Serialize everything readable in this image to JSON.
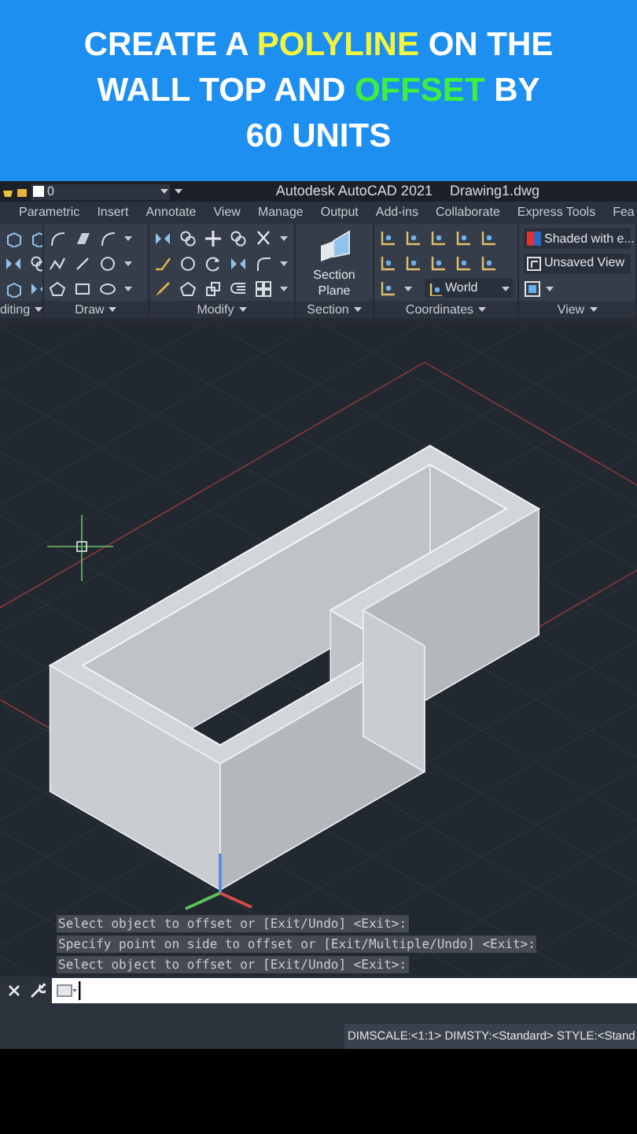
{
  "caption": {
    "lines": [
      [
        {
          "text": "CREATE A ",
          "color": "#ffffff"
        },
        {
          "text": "POLYLINE",
          "color": "#f3f53c"
        },
        {
          "text": " ON THE",
          "color": "#ffffff"
        }
      ],
      [
        {
          "text": "WALL TOP AND ",
          "color": "#ffffff"
        },
        {
          "text": "OFFSET",
          "color": "#3df03d"
        },
        {
          "text": " BY",
          "color": "#ffffff"
        }
      ],
      [
        {
          "text": "60 UNITS",
          "color": "#ffffff"
        }
      ]
    ]
  },
  "title_bar": {
    "layer": "0",
    "title": "Autodesk AutoCAD 2021",
    "file": "Drawing1.dwg"
  },
  "tabs": [
    {
      "label": "Parametric",
      "selected": false
    },
    {
      "label": "Insert",
      "selected": false
    },
    {
      "label": "Annotate",
      "selected": false
    },
    {
      "label": "View",
      "selected": false
    },
    {
      "label": "Manage",
      "selected": false
    },
    {
      "label": "Output",
      "selected": false
    },
    {
      "label": "Add-ins",
      "selected": false
    },
    {
      "label": "Collaborate",
      "selected": false
    },
    {
      "label": "Express Tools",
      "selected": false
    },
    {
      "label": "Fea",
      "selected": false
    }
  ],
  "panels": [
    {
      "label": "diting"
    },
    {
      "label": "Draw"
    },
    {
      "label": "Modify"
    },
    {
      "label": "Section"
    },
    {
      "label": "Coordinates"
    },
    {
      "label": "View"
    }
  ],
  "section_button": "Section Plane",
  "ucs_dropdown": "World",
  "visual_style": "Shaded with e...",
  "named_view": "Unsaved View",
  "command_history": [
    "Select object to offset or [Exit/Undo] <Exit>:",
    "Specify point on side to offset or [Exit/Multiple/Undo] <Exit>:",
    "Select object to offset or [Exit/Undo] <Exit>:"
  ],
  "status_bar": "DIMSCALE:<1:1> DIMSTY:<Standard> STYLE:<Stand"
}
